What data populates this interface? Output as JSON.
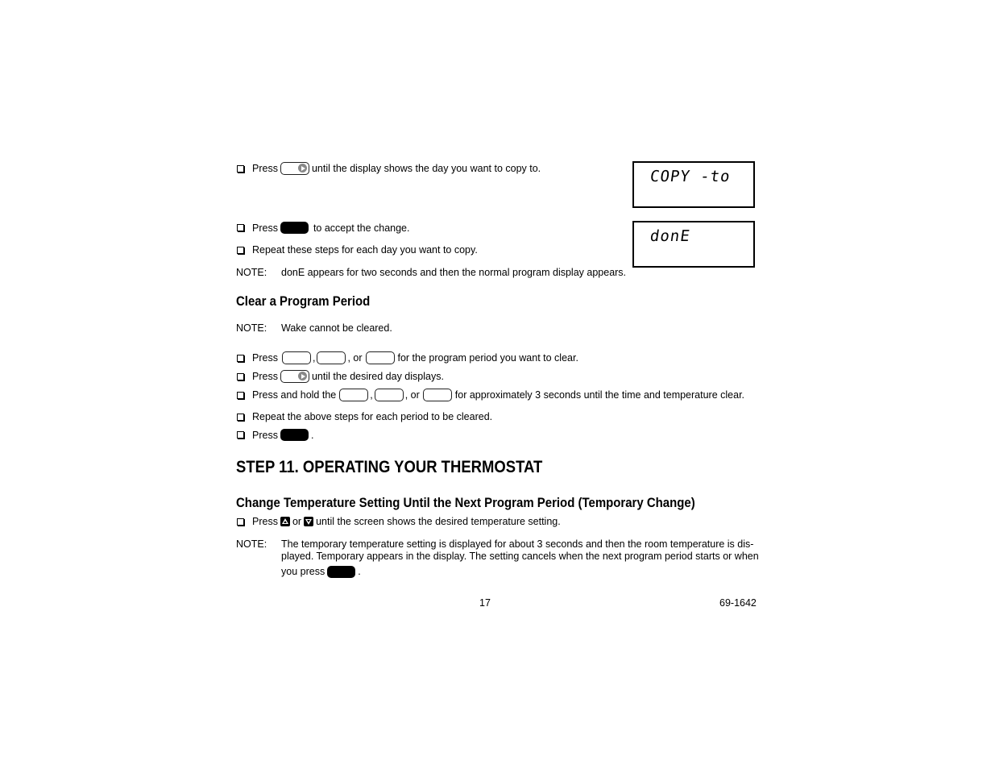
{
  "copy_section": {
    "step1": {
      "before": "Press",
      "after": "until the display shows the day you want to copy to."
    },
    "step2": {
      "before": "Press",
      "after": "to accept the change."
    },
    "step3": {
      "text": "Repeat these steps for each day you want to copy."
    },
    "note": {
      "label": "NOTE:",
      "text": "donE appears for two seconds and then the normal program display appears."
    },
    "lcd_copy_to": "COPY -to",
    "lcd_done": "donE"
  },
  "clear_section": {
    "heading": "Clear a Program Period",
    "note": {
      "label": "NOTE:",
      "text": "Wake cannot be cleared."
    },
    "step1": {
      "before": "Press",
      "sep1": ",",
      "sep2": ", or",
      "after": "for the program period you want to clear."
    },
    "step2": {
      "before": "Press",
      "after": "until the desired day displays."
    },
    "step3": {
      "before": "Press and hold the",
      "sep1": ",",
      "sep2": ", or",
      "after": "for approximately 3 seconds until the time and temperature clear."
    },
    "step4": {
      "text": "Repeat the above steps for each period to be cleared."
    },
    "step5": {
      "before": "Press",
      "after": "."
    }
  },
  "step11": {
    "heading": "STEP 11. OPERATING YOUR THERMOSTAT",
    "subheading": "Change Temperature Setting Until the Next Program Period (Temporary Change)",
    "step1": {
      "before": "Press",
      "mid": "or",
      "after": "until the screen shows the desired temperature setting."
    },
    "note": {
      "label": "NOTE:",
      "line1": "The temporary temperature setting is displayed for about 3 seconds and then the room temperature is dis-",
      "line2": "played. Temporary appears in the display. The setting cancels when the next program period starts or when",
      "line3_before": "you press",
      "line3_after": "."
    }
  },
  "footer": {
    "page_number": "17",
    "doc_number": "69-1642"
  },
  "icons": {
    "arrow_key": "right-arrow-button-icon",
    "black_key": "done-button-icon",
    "blank_key": "period-button-icon",
    "up_key": "up-arrow-button-icon",
    "down_key": "down-arrow-button-icon"
  }
}
